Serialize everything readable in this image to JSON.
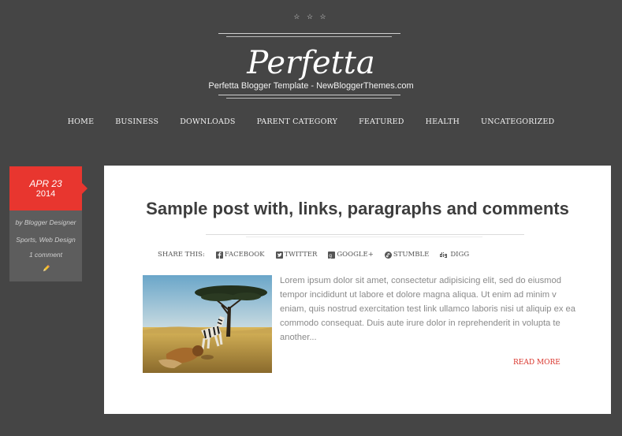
{
  "header": {
    "stars": "☆ ☆ ☆",
    "blog_title": "Perfetta",
    "tagline": "Perfetta Blogger Template - NewBloggerThemes.com"
  },
  "nav": {
    "items": [
      "HOME",
      "BUSINESS",
      "DOWNLOADS",
      "PARENT CATEGORY",
      "FEATURED",
      "HEALTH",
      "UNCATEGORIZED"
    ]
  },
  "post": {
    "date_month_day": "APR 23",
    "date_year": "2014",
    "author": "by Blogger Designer",
    "labels": "Sports, Web Design",
    "comments": "1 comment",
    "edit_icon": "pencil-icon",
    "title": "Sample post with, links, paragraphs and comments",
    "share_label": "SHARE THIS:",
    "share": [
      {
        "icon": "facebook-icon",
        "label": "FACEBOOK"
      },
      {
        "icon": "twitter-icon",
        "label": "TWITTER"
      },
      {
        "icon": "google-plus-icon",
        "label": "GOOGLE+"
      },
      {
        "icon": "stumbleupon-icon",
        "label": "STUMBLE"
      },
      {
        "icon": "digg-icon",
        "label": "DIGG"
      }
    ],
    "thumbnail": "savanna-zebra-lion-illustration",
    "excerpt": "Lorem ipsum dolor sit amet, consectetur adipisicing elit, sed do eiusmod tempor incididunt ut labore et dolore magna aliqua. Ut enim ad minim v eniam, quis nostrud exercitation test link ullamco laboris nisi ut aliquip ex ea commodo consequat. Duis aute irure dolor in reprehenderit in volupta te another...",
    "read_more": "READ MORE"
  },
  "colors": {
    "background": "#454545",
    "accent": "#e8362f",
    "meta_box": "#5d5d5d",
    "card": "#ffffff"
  }
}
